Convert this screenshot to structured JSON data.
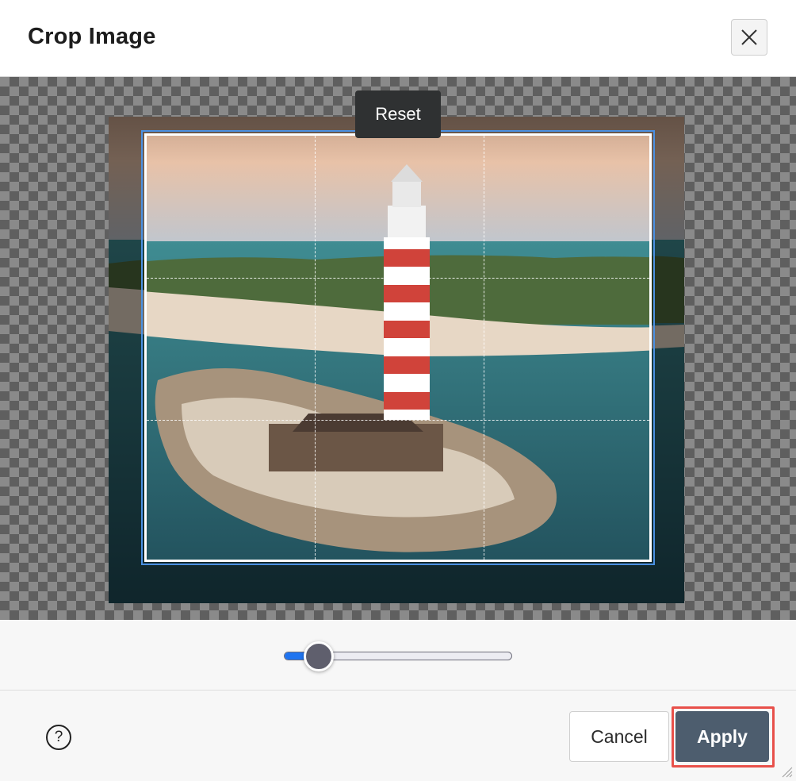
{
  "dialog": {
    "title": "Crop Image",
    "close_icon": "close-icon"
  },
  "crop": {
    "reset_label": "Reset",
    "image_description": "lighthouse-photo",
    "zoom_fraction": 0.15
  },
  "footer": {
    "help_label": "?",
    "cancel_label": "Cancel",
    "apply_label": "Apply"
  },
  "colors": {
    "accent": "#4a90e2",
    "slider_fill": "#1f74f0",
    "apply_bg": "#4d5d6e",
    "apply_highlight": "#e8504a"
  }
}
